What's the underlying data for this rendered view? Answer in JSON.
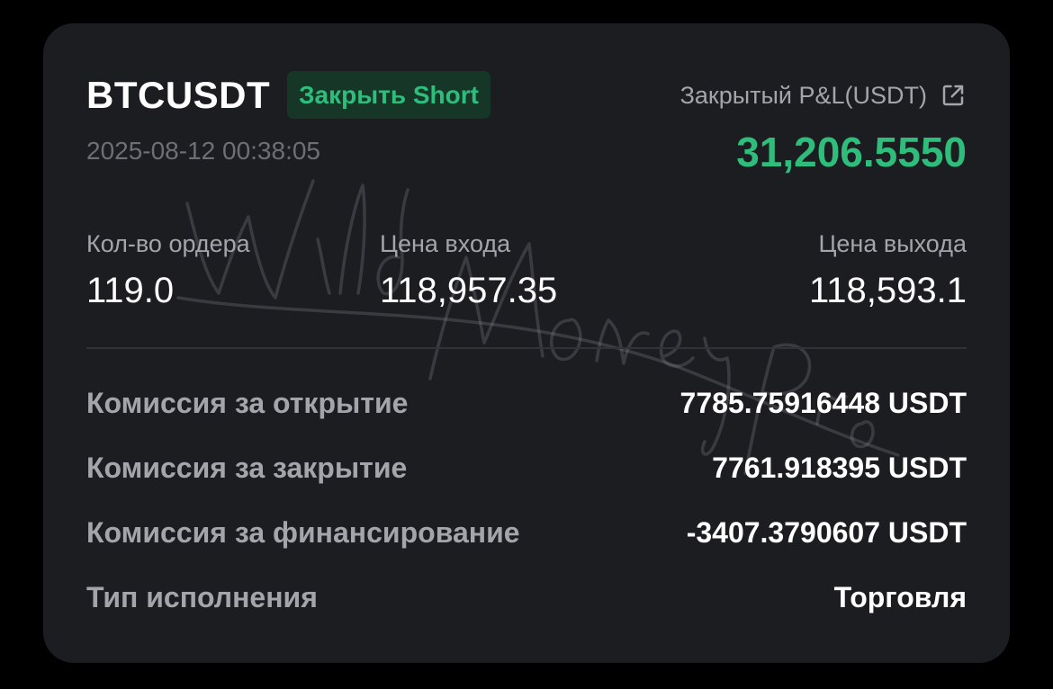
{
  "trade": {
    "symbol": "BTCUSDT",
    "side_badge": "Закрыть Short",
    "timestamp": "2025-08-12 00:38:05",
    "pnl_label": "Закрытый P&L(USDT)",
    "pnl_value": "31,206.5550",
    "icon": "external-link-icon"
  },
  "stats": [
    {
      "label": "Кол-во ордера",
      "value": "119.0"
    },
    {
      "label": "Цена входа",
      "value": "118,957.35"
    },
    {
      "label": "Цена выхода",
      "value": "118,593.1"
    }
  ],
  "details": [
    {
      "label": "Комиссия за открытие",
      "value": "7785.75916448 USDT"
    },
    {
      "label": "Комиссия за закрытие",
      "value": "7761.918395 USDT"
    },
    {
      "label": "Комиссия за финансирование",
      "value": "-3407.3790607 USDT"
    },
    {
      "label": "Тип исполнения",
      "value": "Торговля"
    }
  ],
  "watermark": "Wild Money Pro",
  "colors": {
    "background": "#000000",
    "card": "#1c1d21",
    "accent_green": "#2fbd7b",
    "badge_bg": "#163628",
    "label_gray": "#a3a5ab",
    "timestamp_gray": "#6d6f76",
    "text_white": "#ffffff"
  }
}
